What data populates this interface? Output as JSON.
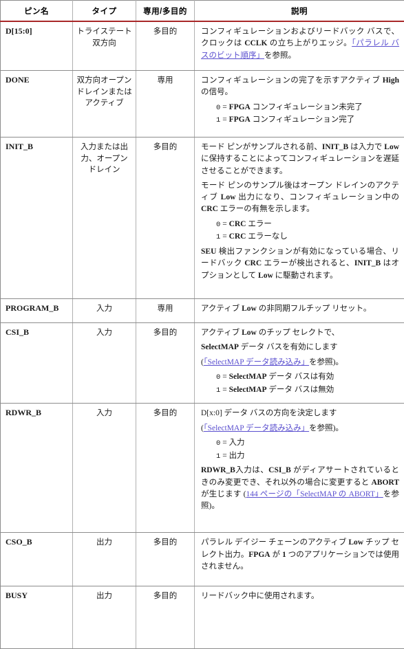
{
  "table": {
    "accent_color": "#a82728",
    "link_color": "#5a4fcf",
    "border_color": "#8c8c8c",
    "columns": [
      {
        "key": "pin",
        "label": "ピン名"
      },
      {
        "key": "type",
        "label": "タイプ"
      },
      {
        "key": "ded",
        "label": "専用/多目的"
      },
      {
        "key": "desc",
        "label": "説明"
      }
    ],
    "rows": [
      {
        "pin": "D[15:0]",
        "type": "トライステート 双方向",
        "ded": "多目的",
        "desc_p1_a": "コンフィギュレーションおよびリードバック バスで、クロックは ",
        "desc_p1_b": "CCLK",
        "desc_p1_c": " の立ち上がりエッジ。",
        "desc_link1": "「パラレル バスのビット順序」",
        "desc_p1_tail": "を参照。"
      },
      {
        "pin": "DONE",
        "type": "双方向オープン ドレインまたはアクティブ",
        "ded": "専用",
        "desc_p1_a": "コンフィギュレーションの完了を示すアクティブ ",
        "desc_p1_b": "High",
        "desc_p1_c": " の信号。",
        "values": [
          {
            "num": "0",
            "eq": " = ",
            "text_b": "FPGA",
            "text": " コンフィギュレーション未完了"
          },
          {
            "num": "1",
            "eq": " = ",
            "text_b": "FPGA",
            "text": " コンフィギュレーション完了"
          }
        ]
      },
      {
        "pin": "INIT_B",
        "type": "入力または出力、オープン ドレイン",
        "ded": "多目的",
        "desc_p1_a": "モード ピンがサンプルされる前、",
        "desc_p1_b": "INIT_B",
        "desc_p1_c": " は入力で ",
        "desc_p1_d": "Low",
        "desc_p1_e": " に保持することによってコンフィギュレーションを遅延させることができます。",
        "desc_p2_a": "モード ピンのサンプル後はオープン ドレインのアクティブ ",
        "desc_p2_b": "Low",
        "desc_p2_c": " 出力になり、コンフィギュレーション中の ",
        "desc_p2_d": "CRC",
        "desc_p2_e": " エラーの有無を示します。",
        "values": [
          {
            "num": "0",
            "eq": " = ",
            "text_b": "CRC",
            "text": " エラー"
          },
          {
            "num": "1",
            "eq": " = ",
            "text_b": "CRC",
            "text": " エラーなし"
          }
        ],
        "desc_p3_a": "SEU",
        "desc_p3_b": " 検出ファンクションが有効になっている場合、リードバック ",
        "desc_p3_c": "CRC",
        "desc_p3_d": " エラーが検出されると、",
        "desc_p3_e": "INIT_B",
        "desc_p3_f": " はオプションとして ",
        "desc_p3_g": "Low",
        "desc_p3_h": " に駆動されます。"
      },
      {
        "pin": "PROGRAM_B",
        "type": "入力",
        "ded": "専用",
        "desc_p1_a": "アクティブ ",
        "desc_p1_b": "Low",
        "desc_p1_c": " の非同期フルチップ リセット。"
      },
      {
        "pin": "CSI_B",
        "type": "入力",
        "ded": "多目的",
        "desc_p1_a": "アクティブ ",
        "desc_p1_b": "Low",
        "desc_p1_c": " のチップ セレクトで、",
        "desc_p2_b": "SelectMAP",
        "desc_p2_c": " データ バスを有効にします",
        "desc_paren_open": "(",
        "desc_link1": "「SelectMAP データ読み込み」",
        "desc_paren_tail": "を参照)。",
        "values": [
          {
            "num": "0",
            "eq": " = ",
            "text_b": "SelectMAP",
            "text": " データ バスは有効"
          },
          {
            "num": "1",
            "eq": " = ",
            "text_b": "SelectMAP",
            "text": " データ バスは無効"
          }
        ]
      },
      {
        "pin": "RDWR_B",
        "type": "入力",
        "ded": "多目的",
        "desc_p1_a": "D[x:0]",
        "desc_p1_b": " データ バスの方向を決定します",
        "desc_paren_open": "(",
        "desc_link1": "「SelectMAP データ読み込み」",
        "desc_paren_tail": "を参照)。",
        "values": [
          {
            "num": "0",
            "eq": " = ",
            "text_b": "",
            "text": "入力"
          },
          {
            "num": "1",
            "eq": " = ",
            "text_b": "",
            "text": "出力"
          }
        ],
        "desc_p3_a": "RDWR_B",
        "desc_p3_b": "入力は、",
        "desc_p3_c": "CSI_B",
        "desc_p3_d": " がディアサートされているときのみ変更でき、それ以外の場合に変更すると ",
        "desc_p3_e": "ABORT",
        "desc_p3_f": " が生じます ",
        "desc_p3_paren": "(",
        "desc_p3_link1": "144 ページの",
        "desc_p3_link2": "「SelectMAP の ABORT」",
        "desc_p3_tail": "を参照)。"
      },
      {
        "pin": "CSO_B",
        "type": "出力",
        "ded": "多目的",
        "desc_p1_a": "パラレル デイジー チェーンのアクティブ ",
        "desc_p1_b": "Low",
        "desc_p1_c": " チップ セレクト出力。",
        "desc_p1_d": "FPGA",
        "desc_p1_e": " が ",
        "desc_p1_f": "1",
        "desc_p1_g": " つのアプリケーションでは使用されません。"
      },
      {
        "pin": "BUSY",
        "type": "出力",
        "ded": "多目的",
        "desc_p1_a": "リードバック中に使用されます。"
      }
    ]
  }
}
